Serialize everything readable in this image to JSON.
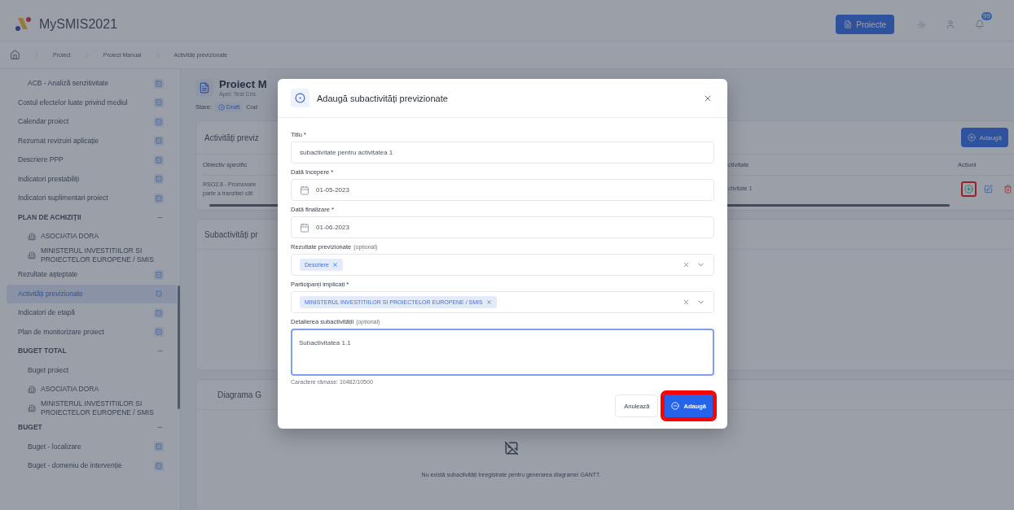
{
  "header": {
    "app_name": "MySMIS2021",
    "projects_button": "Proiecte",
    "notifications_badge": "99"
  },
  "breadcrumb": [
    "Proiect",
    "Proiect Manual",
    "Activități previzionate"
  ],
  "sidebar": {
    "items": [
      {
        "kind": "subitem",
        "label": "ACB - Analiză senzitivitate",
        "checked": true,
        "selected": false
      },
      {
        "kind": "item",
        "label": "Costul efectelor luate privind mediul",
        "checked": true,
        "selected": false
      },
      {
        "kind": "item",
        "label": "Calendar proiect",
        "checked": true,
        "selected": false
      },
      {
        "kind": "item",
        "label": "Rezumat revizuiri aplicație",
        "checked": true,
        "selected": false
      },
      {
        "kind": "item",
        "label": "Descriere PPP",
        "checked": true,
        "selected": false
      },
      {
        "kind": "item",
        "label": "Indicatori prestabiliți",
        "checked": true,
        "selected": false
      },
      {
        "kind": "item",
        "label": "Indicatori suplimentari proiect",
        "checked": true,
        "selected": false
      },
      {
        "kind": "section",
        "label": "PLAN DE ACHIZIȚII",
        "expanded": true,
        "children": [
          {
            "kind": "org",
            "label": "ASOCIATIA DORA",
            "checked": false,
            "selected": false
          },
          {
            "kind": "org",
            "label": "MINISTERUL INVESTITIILOR SI PROIECTELOR EUROPENE / SMIS",
            "checked": false,
            "selected": false
          }
        ]
      },
      {
        "kind": "item",
        "label": "Rezultate așteptate",
        "checked": true,
        "selected": false
      },
      {
        "kind": "item",
        "label": "Activități previzionate",
        "checked": true,
        "selected": true
      },
      {
        "kind": "item",
        "label": "Indicatori de etapă",
        "checked": true,
        "selected": false
      },
      {
        "kind": "item",
        "label": "Plan de monitorizare proiect",
        "checked": true,
        "selected": false
      },
      {
        "kind": "section",
        "label": "BUGET TOTAL",
        "expanded": true,
        "children": [
          {
            "kind": "item",
            "label": "Buget proiect",
            "checked": false,
            "selected": false
          },
          {
            "kind": "org",
            "label": "ASOCIATIA DORA",
            "checked": false,
            "selected": false
          },
          {
            "kind": "org",
            "label": "MINISTERUL INVESTITIILOR SI PROIECTELOR EUROPENE / SMIS",
            "checked": false,
            "selected": false
          }
        ]
      },
      {
        "kind": "section",
        "label": "BUGET",
        "expanded": true,
        "children": [
          {
            "kind": "item",
            "label": "Buget - localizare",
            "checked": true,
            "selected": false
          },
          {
            "kind": "item",
            "label": "Buget - domeniu de intervenție",
            "checked": true,
            "selected": false
          }
        ]
      }
    ]
  },
  "project": {
    "title": "Proiect M",
    "subtitle": "Apel: Test Cris",
    "status_label": "Stare:",
    "status": "Draft",
    "code_label": "Cod"
  },
  "activities": {
    "title": "Activități previz",
    "add_button": "Adaugă",
    "columns": [
      "Obiectiv specific",
      "ctivitate",
      "Acțiuni"
    ],
    "rows": [
      {
        "objective": "RSO2.8 - Promovare\nparte a tranziției căt",
        "activity": "ctivitate 1",
        "add_highlighted": true
      }
    ]
  },
  "subactivities": {
    "title": "Subactivități pr"
  },
  "gantt": {
    "title": "Diagrama G",
    "empty_text": "Nu există subactivități înregistrate pentru generarea diagramei GANTT."
  },
  "modal": {
    "title": "Adaugă subactivități previzionate",
    "fields": [
      {
        "kind": "text",
        "label": "Titlu *",
        "value": "subactivitate pentru activitatea 1"
      },
      {
        "kind": "date",
        "label": "Dată începere *",
        "value": "01-05-2023"
      },
      {
        "kind": "date",
        "label": "Dată finalizare *",
        "value": "01-06-2023"
      },
      {
        "kind": "multiselect",
        "label": "Rezultate previzionate",
        "note": "(opțional)",
        "chips": [
          "Descriere"
        ]
      },
      {
        "kind": "multiselect",
        "label": "Participanți implicați *",
        "chips": [
          "MINISTERUL INVESTITIILOR SI PROIECTELOR EUROPENE / SMIS"
        ]
      },
      {
        "kind": "textarea",
        "label": "Detalierea subactivității",
        "note": "(opțional)",
        "value": "Subactivitatea 1.1",
        "focused": true,
        "helper": "Caractere rămase: 10482/10500"
      }
    ],
    "buttons": [
      {
        "kind": "secondary",
        "label": "Anulează",
        "highlighted": false
      },
      {
        "kind": "primary",
        "label": "Adaugă",
        "highlighted": true
      }
    ]
  }
}
